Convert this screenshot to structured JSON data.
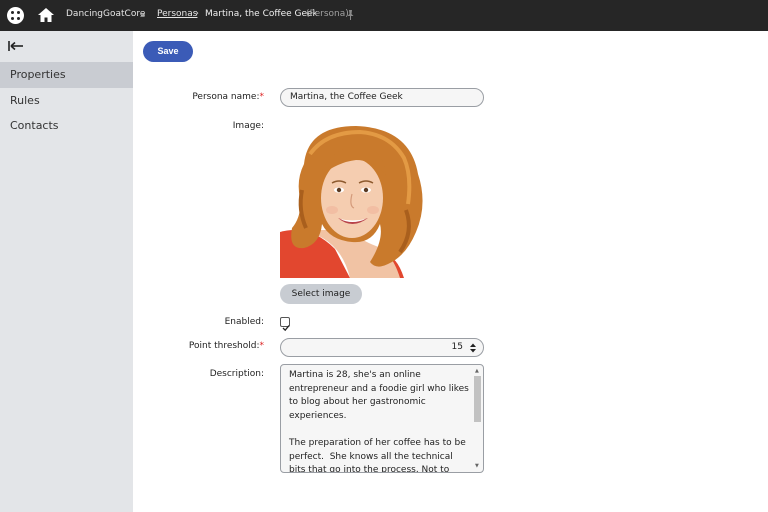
{
  "header": {
    "site_name": "DancingGoatCore",
    "breadcrumb_link": "Personas",
    "breadcrumb_current": "Martina, the Coffee Geek",
    "breadcrumb_type": "(Persona)"
  },
  "sidebar": {
    "items": [
      {
        "label": "Properties",
        "active": true
      },
      {
        "label": "Rules",
        "active": false
      },
      {
        "label": "Contacts",
        "active": false
      }
    ]
  },
  "toolbar": {
    "save_label": "Save"
  },
  "form": {
    "persona_name_label": "Persona name:",
    "persona_name_value": "Martina, the Coffee Geek",
    "image_label": "Image:",
    "select_image_label": "Select image",
    "enabled_label": "Enabled:",
    "enabled_checked": true,
    "point_threshold_label": "Point threshold:",
    "point_threshold_value": "15",
    "description_label": "Description:",
    "description_value": "Martina is 28, she's an online entrepreneur and a foodie girl who likes to blog about her gastronomic experiences.\n\nThe preparation of her coffee has to be perfect.  She knows all the technical bits that go into the process. Not to leave things to chance, she also owns a professional",
    "required_marker": "*"
  },
  "colors": {
    "topbar": "#262626",
    "sidebar": "#e3e5e8",
    "sidebar_active": "#c9ccd2",
    "primary_button": "#3b5bb7",
    "required": "#d22222"
  }
}
